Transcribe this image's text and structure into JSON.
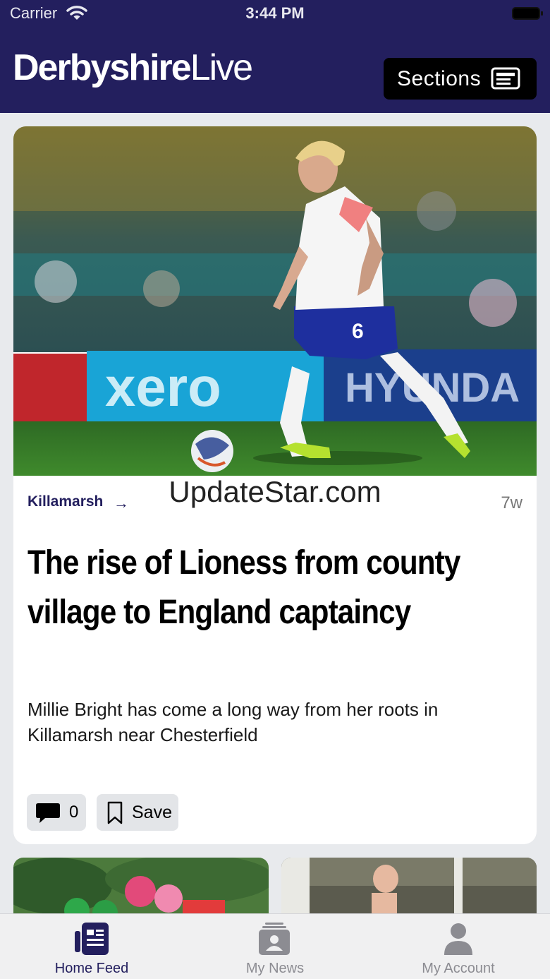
{
  "status_bar": {
    "carrier": "Carrier",
    "time": "3:44 PM"
  },
  "header": {
    "logo_bold": "Derbyshire",
    "logo_light": "Live",
    "sections_label": "Sections",
    "background_color": "#231f5e"
  },
  "article": {
    "category": "Killamarsh",
    "age": "7w",
    "headline": "The rise of Lioness from county village to England captaincy",
    "standfirst": "Millie Bright has come a long way from her roots in Killamarsh near Chesterfield",
    "comment_count": "0",
    "save_label": "Save",
    "hero_image": "footballer-in-england-kit-dribbling-ball"
  },
  "watermark": "UpdateStar.com",
  "more_stories": [
    {
      "image": "horse-racing-jockeys"
    },
    {
      "image": "person-thumbs-up-in-stadium"
    }
  ],
  "tabbar": {
    "tabs": [
      {
        "label": "Home Feed",
        "icon": "home-feed-icon",
        "active": true
      },
      {
        "label": "My News",
        "icon": "my-news-icon",
        "active": false
      },
      {
        "label": "My Account",
        "icon": "account-icon",
        "active": false
      }
    ]
  }
}
